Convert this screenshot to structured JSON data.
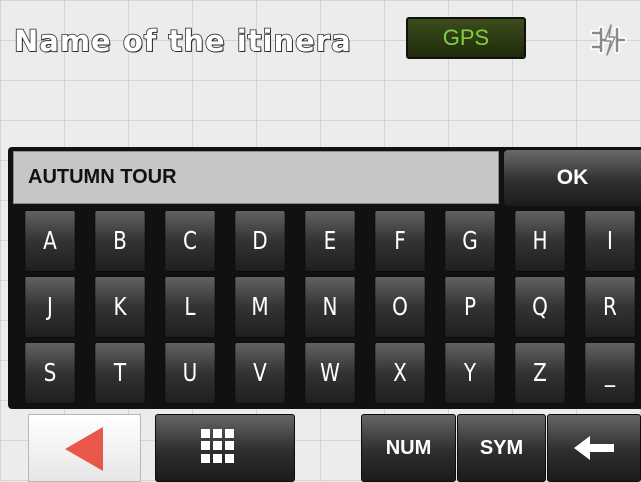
{
  "header": {
    "title": "Name of the itinera",
    "gps_label": "GPS",
    "power_icon": "power-plug-icon"
  },
  "input": {
    "value": "AUTUMN TOUR",
    "ok_label": "OK"
  },
  "keyboard": {
    "rows": [
      [
        "A",
        "B",
        "C",
        "D",
        "E",
        "F",
        "G",
        "H",
        "I"
      ],
      [
        "J",
        "K",
        "L",
        "M",
        "N",
        "O",
        "P",
        "Q",
        "R"
      ],
      [
        "S",
        "T",
        "U",
        "V",
        "W",
        "X",
        "Y",
        "Z",
        "_"
      ]
    ]
  },
  "bottom_bar": {
    "back_icon": "back-arrow-icon",
    "layout_icon": "keyboard-grid-icon",
    "num_label": "NUM",
    "sym_label": "SYM",
    "backspace_icon": "backspace-arrow-icon"
  },
  "colors": {
    "gps_text": "#7fd13b",
    "back_arrow": "#e8574a"
  }
}
